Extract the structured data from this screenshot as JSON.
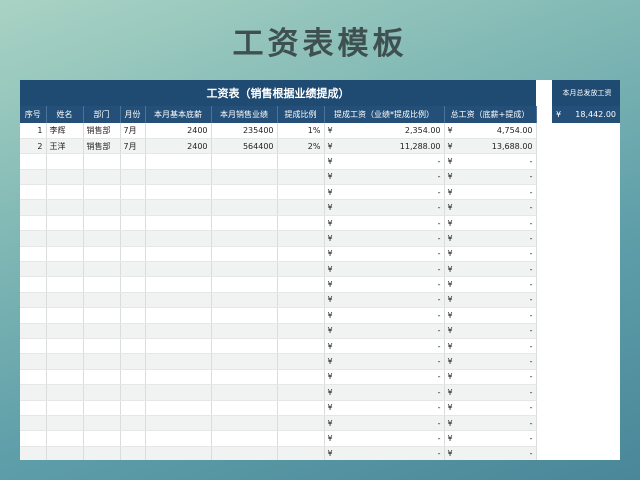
{
  "page_title": "工资表模板",
  "table_title": "工资表（销售根据业绩提成）",
  "columns": [
    "序号",
    "姓名",
    "部门",
    "月份",
    "本月基本底薪",
    "本月销售业绩",
    "提成比例",
    "提成工资（业绩*提成比例）",
    "总工资（底薪+提成）"
  ],
  "rows": [
    {
      "no": "1",
      "name": "李辉",
      "dept": "销售部",
      "month": "7月",
      "base": "2400",
      "sales": "235400",
      "rate": "1%",
      "commission": "2,354.00",
      "total": "4,754.00"
    },
    {
      "no": "2",
      "name": "王洋",
      "dept": "销售部",
      "month": "7月",
      "base": "2400",
      "sales": "564400",
      "rate": "2%",
      "commission": "11,288.00",
      "total": "13,688.00"
    }
  ],
  "empty_value": "-",
  "currency": "¥",
  "empty_row_count": 20,
  "summary": {
    "label": "本月总发放工资",
    "currency": "¥",
    "value": "18,442.00"
  }
}
